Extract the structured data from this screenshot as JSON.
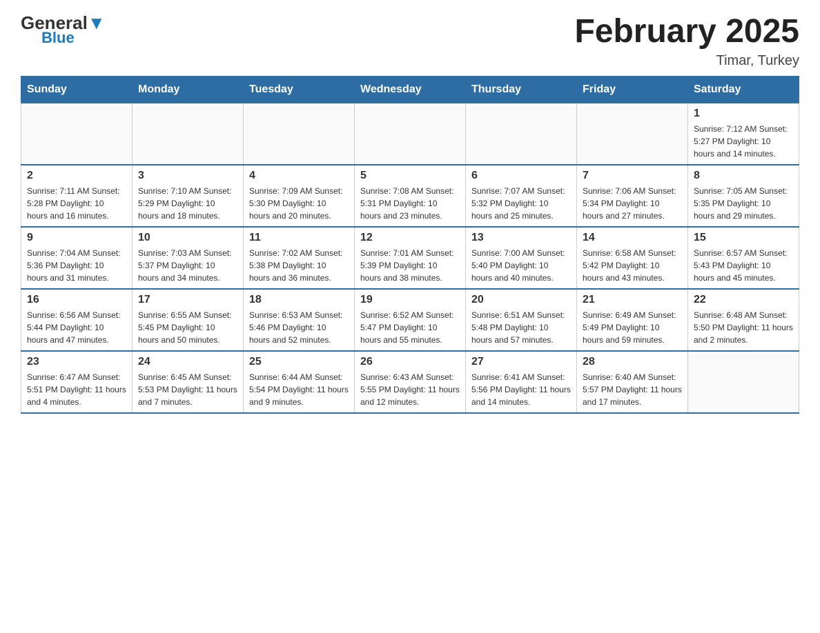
{
  "logo": {
    "general": "General",
    "blue": "Blue",
    "triangle": "▼"
  },
  "title": "February 2025",
  "location": "Timar, Turkey",
  "days_of_week": [
    "Sunday",
    "Monday",
    "Tuesday",
    "Wednesday",
    "Thursday",
    "Friday",
    "Saturday"
  ],
  "weeks": [
    [
      {
        "day": "",
        "info": ""
      },
      {
        "day": "",
        "info": ""
      },
      {
        "day": "",
        "info": ""
      },
      {
        "day": "",
        "info": ""
      },
      {
        "day": "",
        "info": ""
      },
      {
        "day": "",
        "info": ""
      },
      {
        "day": "1",
        "info": "Sunrise: 7:12 AM\nSunset: 5:27 PM\nDaylight: 10 hours and 14 minutes."
      }
    ],
    [
      {
        "day": "2",
        "info": "Sunrise: 7:11 AM\nSunset: 5:28 PM\nDaylight: 10 hours and 16 minutes."
      },
      {
        "day": "3",
        "info": "Sunrise: 7:10 AM\nSunset: 5:29 PM\nDaylight: 10 hours and 18 minutes."
      },
      {
        "day": "4",
        "info": "Sunrise: 7:09 AM\nSunset: 5:30 PM\nDaylight: 10 hours and 20 minutes."
      },
      {
        "day": "5",
        "info": "Sunrise: 7:08 AM\nSunset: 5:31 PM\nDaylight: 10 hours and 23 minutes."
      },
      {
        "day": "6",
        "info": "Sunrise: 7:07 AM\nSunset: 5:32 PM\nDaylight: 10 hours and 25 minutes."
      },
      {
        "day": "7",
        "info": "Sunrise: 7:06 AM\nSunset: 5:34 PM\nDaylight: 10 hours and 27 minutes."
      },
      {
        "day": "8",
        "info": "Sunrise: 7:05 AM\nSunset: 5:35 PM\nDaylight: 10 hours and 29 minutes."
      }
    ],
    [
      {
        "day": "9",
        "info": "Sunrise: 7:04 AM\nSunset: 5:36 PM\nDaylight: 10 hours and 31 minutes."
      },
      {
        "day": "10",
        "info": "Sunrise: 7:03 AM\nSunset: 5:37 PM\nDaylight: 10 hours and 34 minutes."
      },
      {
        "day": "11",
        "info": "Sunrise: 7:02 AM\nSunset: 5:38 PM\nDaylight: 10 hours and 36 minutes."
      },
      {
        "day": "12",
        "info": "Sunrise: 7:01 AM\nSunset: 5:39 PM\nDaylight: 10 hours and 38 minutes."
      },
      {
        "day": "13",
        "info": "Sunrise: 7:00 AM\nSunset: 5:40 PM\nDaylight: 10 hours and 40 minutes."
      },
      {
        "day": "14",
        "info": "Sunrise: 6:58 AM\nSunset: 5:42 PM\nDaylight: 10 hours and 43 minutes."
      },
      {
        "day": "15",
        "info": "Sunrise: 6:57 AM\nSunset: 5:43 PM\nDaylight: 10 hours and 45 minutes."
      }
    ],
    [
      {
        "day": "16",
        "info": "Sunrise: 6:56 AM\nSunset: 5:44 PM\nDaylight: 10 hours and 47 minutes."
      },
      {
        "day": "17",
        "info": "Sunrise: 6:55 AM\nSunset: 5:45 PM\nDaylight: 10 hours and 50 minutes."
      },
      {
        "day": "18",
        "info": "Sunrise: 6:53 AM\nSunset: 5:46 PM\nDaylight: 10 hours and 52 minutes."
      },
      {
        "day": "19",
        "info": "Sunrise: 6:52 AM\nSunset: 5:47 PM\nDaylight: 10 hours and 55 minutes."
      },
      {
        "day": "20",
        "info": "Sunrise: 6:51 AM\nSunset: 5:48 PM\nDaylight: 10 hours and 57 minutes."
      },
      {
        "day": "21",
        "info": "Sunrise: 6:49 AM\nSunset: 5:49 PM\nDaylight: 10 hours and 59 minutes."
      },
      {
        "day": "22",
        "info": "Sunrise: 6:48 AM\nSunset: 5:50 PM\nDaylight: 11 hours and 2 minutes."
      }
    ],
    [
      {
        "day": "23",
        "info": "Sunrise: 6:47 AM\nSunset: 5:51 PM\nDaylight: 11 hours and 4 minutes."
      },
      {
        "day": "24",
        "info": "Sunrise: 6:45 AM\nSunset: 5:53 PM\nDaylight: 11 hours and 7 minutes."
      },
      {
        "day": "25",
        "info": "Sunrise: 6:44 AM\nSunset: 5:54 PM\nDaylight: 11 hours and 9 minutes."
      },
      {
        "day": "26",
        "info": "Sunrise: 6:43 AM\nSunset: 5:55 PM\nDaylight: 11 hours and 12 minutes."
      },
      {
        "day": "27",
        "info": "Sunrise: 6:41 AM\nSunset: 5:56 PM\nDaylight: 11 hours and 14 minutes."
      },
      {
        "day": "28",
        "info": "Sunrise: 6:40 AM\nSunset: 5:57 PM\nDaylight: 11 hours and 17 minutes."
      },
      {
        "day": "",
        "info": ""
      }
    ]
  ]
}
